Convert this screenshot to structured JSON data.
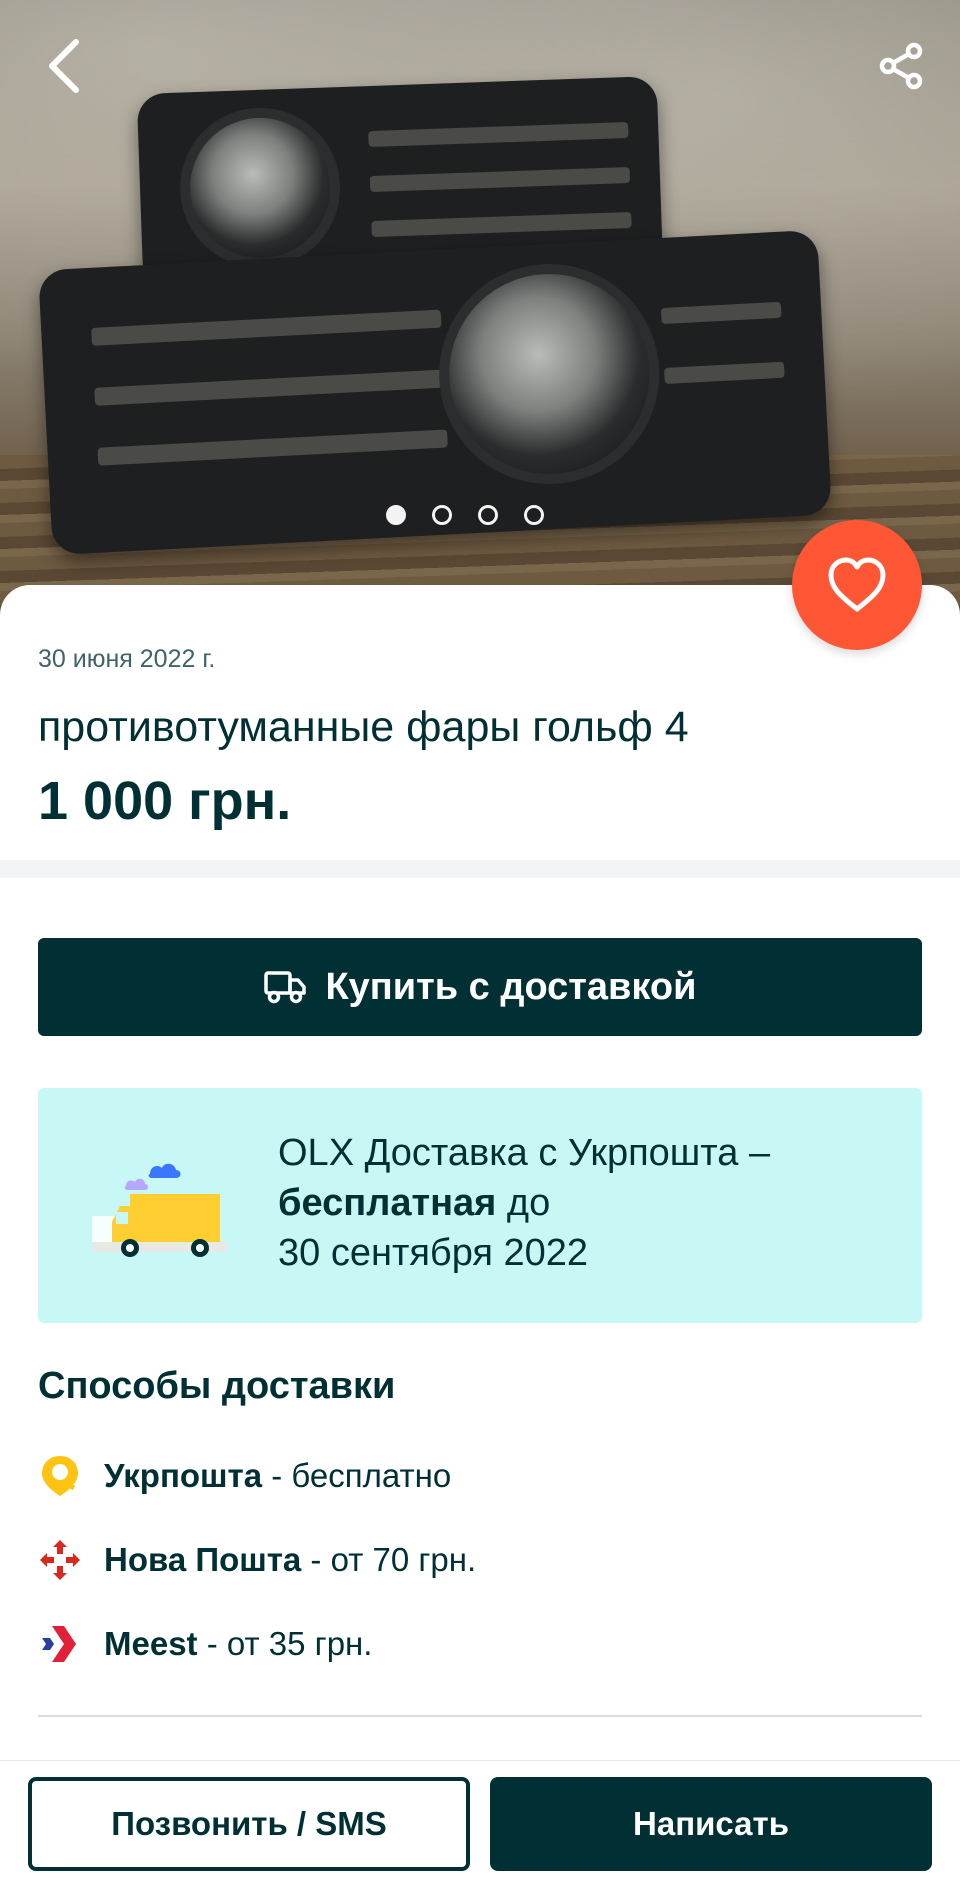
{
  "gallery": {
    "image_alt": "противотуманные фары гольф 4",
    "current_slide": 1,
    "slide_count": 4,
    "back_icon": "chevron-left-icon",
    "share_icon": "share-icon",
    "favorite_icon": "heart-icon",
    "favorite_color": "#ff5636"
  },
  "ad": {
    "date": "30 июня 2022 г.",
    "title": "противотуманные фары гольф 4",
    "price": "1 000 грн."
  },
  "buy_button": {
    "icon": "delivery-truck-icon",
    "label": "Купить с доставкой"
  },
  "promo": {
    "line1": "OLX Доставка с Укрпошта –",
    "bold": "бесплатная",
    "after_bold": " до",
    "line3": "30 сентября 2022",
    "background": "#c8f8f6"
  },
  "delivery": {
    "title": "Способы доставки",
    "methods": [
      {
        "name": "Укрпошта",
        "price": " - бесплатно",
        "icon": "ukrposhta-icon"
      },
      {
        "name": "Нова Пошта",
        "price": " - от 70 грн.",
        "icon": "nova-poshta-icon"
      },
      {
        "name": "Meest",
        "price": " - от 35 грн.",
        "icon": "meest-icon"
      }
    ]
  },
  "bottom_bar": {
    "call_label": "Позвонить / SMS",
    "message_label": "Написать"
  },
  "colors": {
    "primary": "#002f34",
    "accent": "#ff5636",
    "promo_bg": "#c8f8f6"
  }
}
